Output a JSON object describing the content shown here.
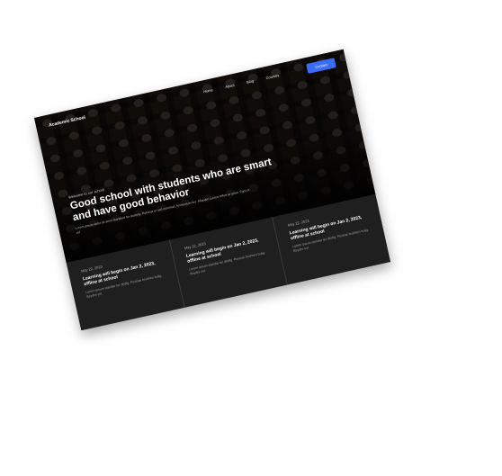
{
  "nav": {
    "brand": "Academic School",
    "links": [
      "Home",
      "About",
      "Blog",
      "Courses"
    ],
    "cta": "Contact"
  },
  "hero": {
    "eyebrow": "Welcome to our school",
    "title": "Good school with students who are smart and have good behavior",
    "subtitle": "Lorem ipsum dolor sit amet standard for dummy. Pulvinar et sed euismod, fermentum leo. Aliquam cursus tellus at tortor. Eget et vel"
  },
  "news": [
    {
      "date": "May 22, 2023",
      "title": "Learning will begin on Jan 2, 2023, offline at school",
      "text": "Lorem ipsum standar ter dhdfg. Povinar bruhhen bolig. Beydre est"
    },
    {
      "date": "May 22, 2023",
      "title": "Learning will begin on Jan 2, 2023, offline at school",
      "text": "Lorem ipsum standar ter dhdfg. Povinar bruhhen bolig. Beydre est"
    },
    {
      "date": "May 22, 2023",
      "title": "Learning will begin on Jan 2, 2023, offline at school",
      "text": "Lorem ipsum standar ter dhdfg. Povinar bruhhen bolig. Beydre est"
    }
  ]
}
